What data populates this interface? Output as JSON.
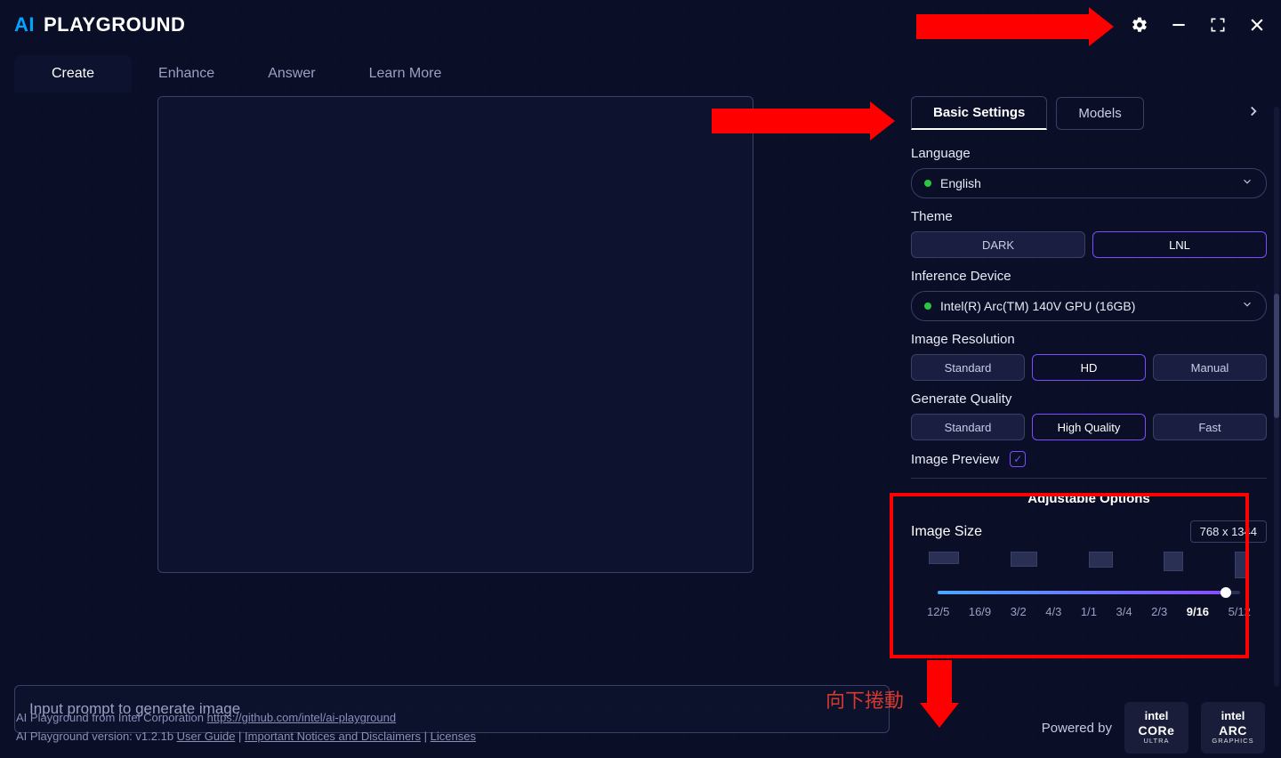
{
  "app": {
    "logo_ai": "AI",
    "logo_pg": "PLAYGROUND"
  },
  "tabs": {
    "create": "Create",
    "enhance": "Enhance",
    "answer": "Answer",
    "learn": "Learn More"
  },
  "prompt": {
    "placeholder": "Input prompt to generate image"
  },
  "settings_tabs": {
    "basic": "Basic Settings",
    "models": "Models"
  },
  "language": {
    "label": "Language",
    "value": "English"
  },
  "theme": {
    "label": "Theme",
    "dark": "DARK",
    "lnl": "LNL"
  },
  "device": {
    "label": "Inference Device",
    "value": "Intel(R) Arc(TM) 140V GPU (16GB)"
  },
  "resolution": {
    "label": "Image Resolution",
    "standard": "Standard",
    "hd": "HD",
    "manual": "Manual"
  },
  "quality": {
    "label": "Generate Quality",
    "standard": "Standard",
    "high": "High Quality",
    "fast": "Fast"
  },
  "preview": {
    "label": "Image Preview"
  },
  "adjustable": {
    "title": "Adjustable Options",
    "imagesize_label": "Image Size",
    "imagesize_value": "768 x 1344",
    "ratios": [
      "12/5",
      "16/9",
      "3/2",
      "4/3",
      "1/1",
      "3/4",
      "2/3",
      "9/16",
      "5/12"
    ],
    "selected_index": 7
  },
  "footer": {
    "line1_pre": "AI Playground from Intel Corporation ",
    "repo": "https://github.com/intel/ai-playground",
    "line2_pre": "AI Playground version: v1.2.1b ",
    "user_guide": "User Guide",
    "notices": "Important Notices and Disclaimers",
    "licenses": "Licenses",
    "sep": " | ",
    "powered": "Powered by",
    "badge1a": "intel",
    "badge1b": "CORe",
    "badge1c": "ULTRA",
    "badge2a": "intel",
    "badge2b": "ARC",
    "badge2c": "GRAPHICS"
  },
  "anno": {
    "scroll_down": "向下捲動"
  }
}
